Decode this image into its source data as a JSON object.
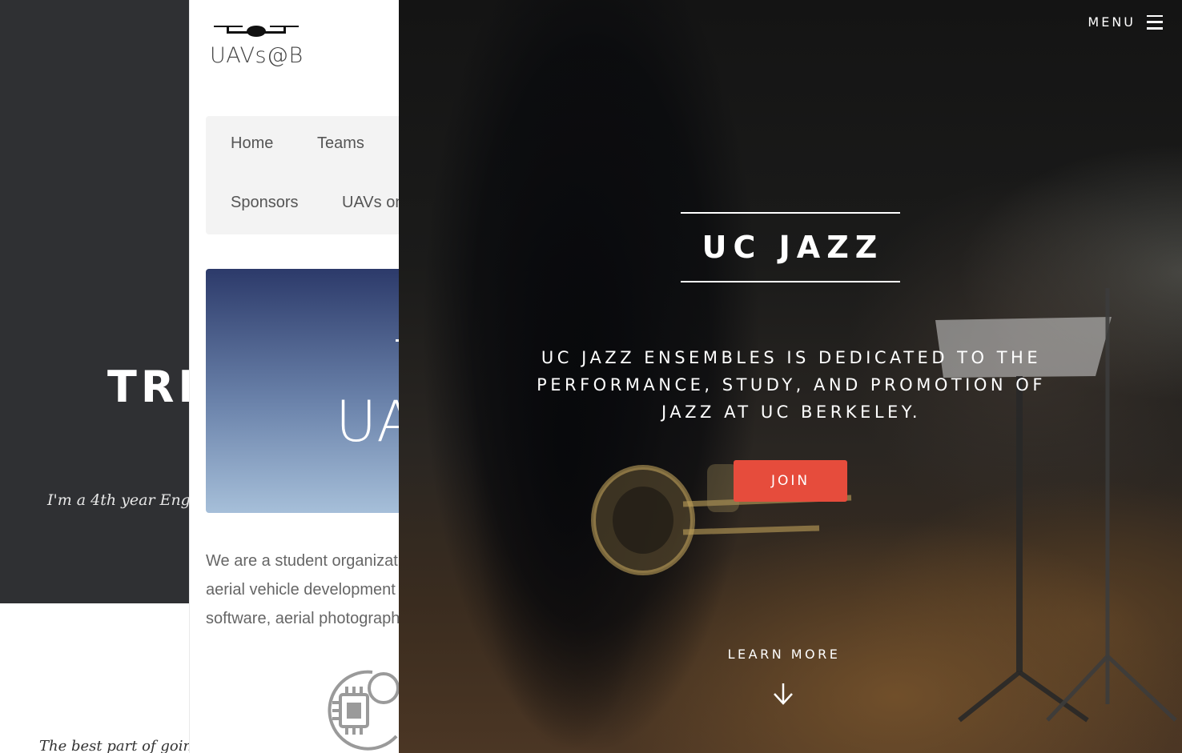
{
  "panel_left": {
    "hero_title": "TRE",
    "hero_subtitle": "I'm a 4th year Engin",
    "body_teaser": "The best part of going"
  },
  "panel_middle": {
    "logo_text": "UAVs@B",
    "nav": {
      "home": "Home",
      "teams": "Teams",
      "sponsors": "Sponsors",
      "uavs": "UAVs on"
    },
    "banner_text": "UA",
    "intro_lines": [
      "We are a student organizat",
      "aerial vehicle development",
      "software, aerial photograph"
    ]
  },
  "panel_right": {
    "menu_label": "MENU",
    "title": "UC JAZZ",
    "description_lines": [
      "UC JAZZ ENSEMBLES IS DEDICATED TO THE",
      "PERFORMANCE, STUDY, AND PROMOTION OF",
      "JAZZ AT UC BERKELEY."
    ],
    "join_label": "JOIN",
    "learn_more_label": "LEARN MORE",
    "accent_color": "#e64c3c"
  }
}
